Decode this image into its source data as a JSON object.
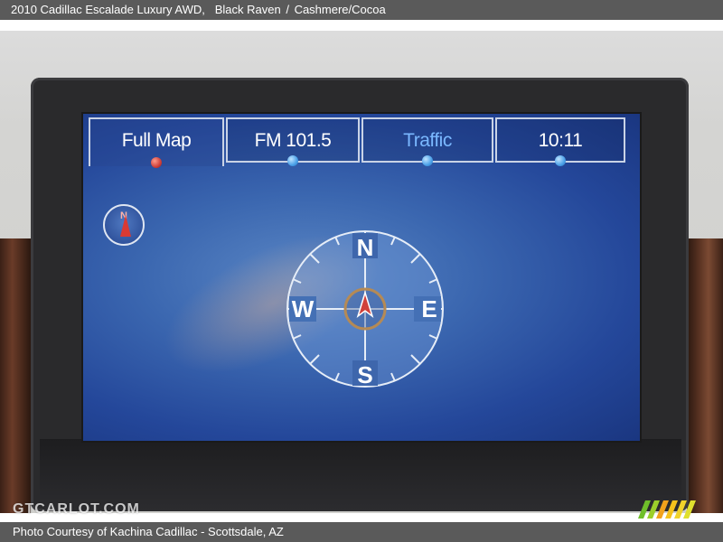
{
  "caption": {
    "vehicle": "2010 Cadillac Escalade Luxury AWD,",
    "exterior": "Black Raven",
    "separator": "/",
    "interior": "Cashmere/Cocoa"
  },
  "nav": {
    "tabs": [
      {
        "label": "Full Map",
        "active": true,
        "indicator": "red"
      },
      {
        "label": "FM 101.5",
        "active": false,
        "indicator": "blue"
      },
      {
        "label": "Traffic",
        "active": false,
        "indicator": "blue"
      },
      {
        "label": "10:11",
        "active": false,
        "indicator": "blue"
      }
    ],
    "mini_compass_label": "N",
    "compass": {
      "north": "N",
      "south": "S",
      "east": "E",
      "west": "W"
    }
  },
  "watermark": "GTCARLOT.COM",
  "footer": "Photo Courtesy of Kachina Cadillac - Scottsdale, AZ",
  "colors": {
    "caption_bg": "#5a5a5a",
    "screen_blue": "#2d56a6",
    "traffic_text": "#7ab8ff",
    "heading_arrow": "#d93a33"
  }
}
